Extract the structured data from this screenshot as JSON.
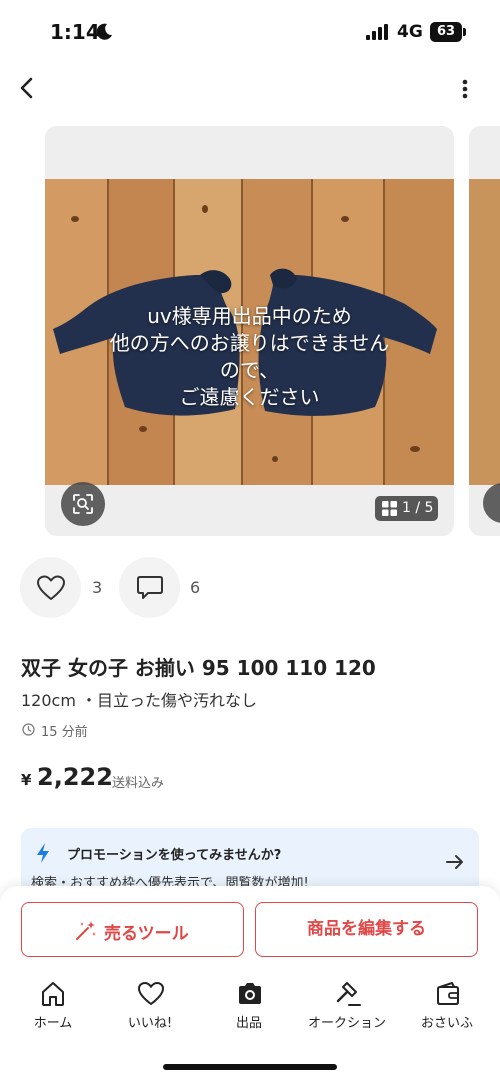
{
  "status_bar": {
    "time": "1:14",
    "network": "4G",
    "battery": "63",
    "icons": [
      "moon-icon",
      "signal-icon",
      "battery-icon"
    ]
  },
  "header": {
    "back_icon": "chevron-left-icon",
    "more_icon": "more-vertical-icon"
  },
  "carousel": {
    "overlay_lines": [
      "uv様専用出品中のため",
      "他の方へのお譲りはできません",
      "ので、",
      "ご遠慮ください"
    ],
    "page_counter": "1 / 5",
    "lens_icon": "image-search-icon"
  },
  "reactions": {
    "likes": "3",
    "comments": "6"
  },
  "item": {
    "title": "双子 女の子 お揃い 95 100 110 120",
    "subtitle": "120cm ・目立った傷や汚れなし",
    "posted": "15 分前",
    "currency": "¥",
    "price": "2,222",
    "shipping": "送料込み"
  },
  "promo": {
    "title": "プロモーションを使ってみませんか?",
    "description": "検索・おすすめ枠へ優先表示で、閲覧数が増加!"
  },
  "actions": {
    "sell_tools": "売るツール",
    "edit_item": "商品を編集する"
  },
  "tabs": [
    {
      "label": "ホーム",
      "icon": "home-icon"
    },
    {
      "label": "いいね!",
      "icon": "heart-icon"
    },
    {
      "label": "出品",
      "icon": "camera-icon"
    },
    {
      "label": "オークション",
      "icon": "gavel-icon"
    },
    {
      "label": "おさいふ",
      "icon": "wallet-icon"
    }
  ],
  "colors": {
    "accent": "#e04848",
    "promo_bg": "#eaf3fd",
    "bolt": "#1e7be6"
  }
}
